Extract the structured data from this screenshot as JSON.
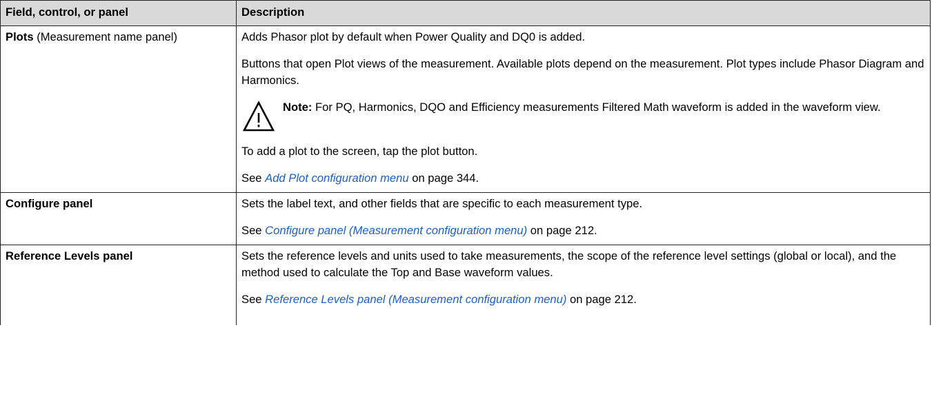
{
  "table": {
    "headers": [
      "Field, control, or panel",
      "Description"
    ],
    "rows": [
      {
        "field_bold": "Plots",
        "field_rest": " (Measurement name panel)",
        "paragraphs": [
          "Adds Phasor plot by default when Power Quality and DQ0 is added.",
          "Buttons that open Plot views of the measurement. Available plots depend on the measurement. Plot types include Phasor Diagram and Harmonics."
        ],
        "note": {
          "icon": "warning-triangle-icon",
          "label": "Note:",
          "text": " For PQ, Harmonics, DQO and Efficiency measurements Filtered Math waveform is added in the waveform view."
        },
        "after_note": "To add a plot to the screen, tap the plot button.",
        "see": {
          "prefix": "See ",
          "link": "Add Plot configuration menu",
          "suffix": " on page 344."
        }
      },
      {
        "field_bold": "Configure panel",
        "paragraphs": [
          "Sets the label text, and other fields that are specific to each measurement type."
        ],
        "see": {
          "prefix": "See ",
          "link": "Configure panel (Measurement configuration menu)",
          "suffix": " on page 212."
        }
      },
      {
        "field_bold": "Reference Levels panel",
        "paragraphs": [
          "Sets the reference levels and units used to take measurements, the scope of the reference level settings (global or local), and the method used to calculate the Top and Base waveform values."
        ],
        "see": {
          "prefix": "See ",
          "link": "Reference Levels panel (Measurement configuration menu)",
          "suffix": " on page 212."
        }
      }
    ]
  },
  "colors": {
    "header_bg": "#d9d9d9",
    "link": "#1a5fd0",
    "border": "#222222"
  }
}
